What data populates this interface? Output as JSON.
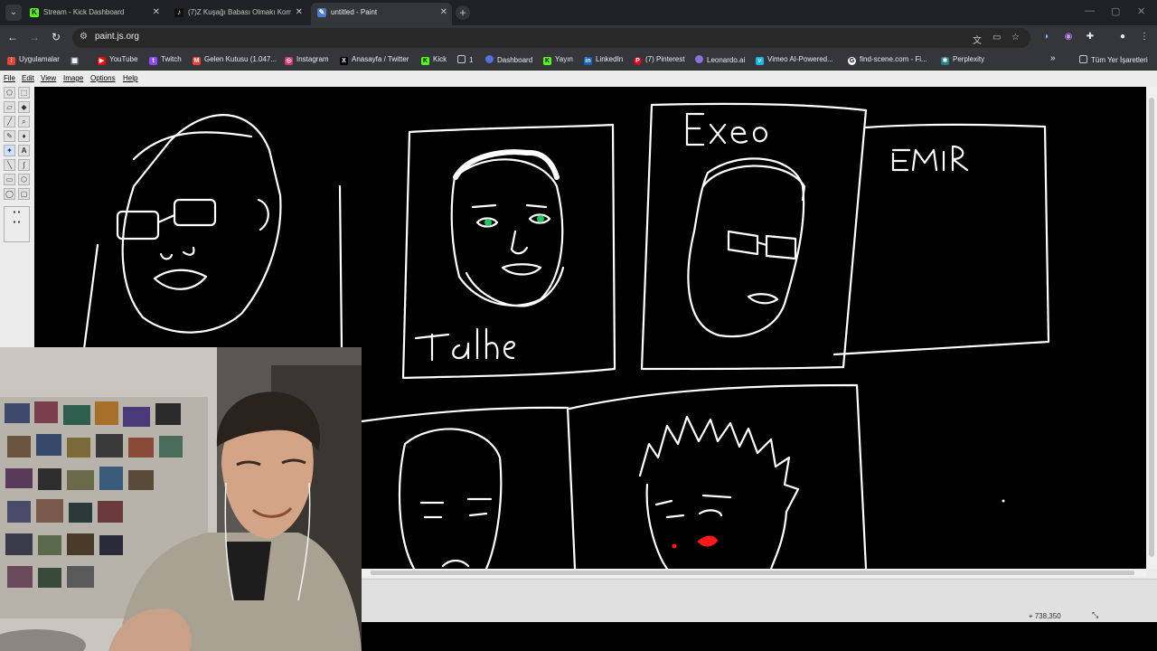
{
  "browser": {
    "tabs": [
      {
        "title": "Stream - Kick Dashboard",
        "icon": "kick-icon",
        "color": "#53fc18"
      },
      {
        "title": "(7)Z Kuşağı Babası Olmakı Komı",
        "icon": "tiktok-icon",
        "color": "#111111"
      },
      {
        "title": "untitled - Paint",
        "icon": "paint-icon",
        "color": "#4a7bd0"
      }
    ],
    "url": "paint.js.org"
  },
  "bookmarks": [
    {
      "label": "Uygulamalar",
      "icon": "apps-icon",
      "color": "#ea4335"
    },
    {
      "label": "",
      "icon": "grid-icon",
      "color": "#5f6368"
    },
    {
      "label": "YouTube",
      "icon": "youtube-icon",
      "color": "#ff0000"
    },
    {
      "label": "Twitch",
      "icon": "twitch-icon",
      "color": "#9146ff"
    },
    {
      "label": "Gelen Kutusu (1.047...",
      "icon": "gmail-icon",
      "color": "#ea4335"
    },
    {
      "label": "Instagram",
      "icon": "instagram-icon",
      "color": "#e1306c"
    },
    {
      "label": "Anasayfa / Twitter",
      "icon": "x-icon",
      "color": "#000000"
    },
    {
      "label": "Kick",
      "icon": "kick-icon",
      "color": "#53fc18"
    },
    {
      "label": "1",
      "icon": "folder-icon",
      "color": "#35363a"
    },
    {
      "label": "Dashboard",
      "icon": "dashboard-icon",
      "color": "#5b6ee1"
    },
    {
      "label": "Yayın",
      "icon": "kick-icon",
      "color": "#53fc18"
    },
    {
      "label": "LinkedIn",
      "icon": "linkedin-icon",
      "color": "#0a66c2"
    },
    {
      "label": "(7) Pinterest",
      "icon": "pinterest-icon",
      "color": "#e60023"
    },
    {
      "label": "Leonardo.ai",
      "icon": "leonardo-icon",
      "color": "#8a6fdf"
    },
    {
      "label": "Vimeo AI-Powered...",
      "icon": "vimeo-icon",
      "color": "#1ab7ea"
    },
    {
      "label": "find-scene.com - Fi...",
      "icon": "findscene-icon",
      "color": "#ffffff"
    },
    {
      "label": "Perplexity",
      "icon": "perplexity-icon",
      "color": "#20808d"
    }
  ],
  "bookmarks_more": "»",
  "all_bookmarks": "Tüm Yer İşaretleri",
  "paint": {
    "menu": [
      "File",
      "Edit",
      "View",
      "Image",
      "Options",
      "Help"
    ],
    "status_coords": "738,350",
    "labels": {
      "talha": "Talha",
      "exeo": "Exeo",
      "emir": "EMIR"
    }
  }
}
